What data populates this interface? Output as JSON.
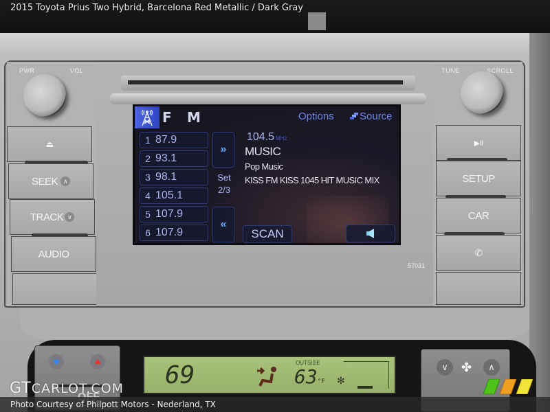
{
  "title": "2015 Toyota Prius Two Hybrid,  Barcelona Red Metallic / Dark Gray",
  "caption": "Photo Courtesy of Philpott Motors - Nederland, TX",
  "watermark": {
    "prefix": "GT",
    "rest": "CARLOT.COM"
  },
  "head_unit": {
    "left_knob": {
      "label_left": "PWR",
      "label_right": "VOL"
    },
    "right_knob": {
      "label_left": "TUNE",
      "label_right": "SCROLL"
    },
    "left_buttons": [
      {
        "id": "eject",
        "label": "⏏"
      },
      {
        "id": "seek",
        "label": "SEEK"
      },
      {
        "id": "track",
        "label": "TRACK"
      },
      {
        "id": "audio",
        "label": "AUDIO"
      }
    ],
    "right_buttons": [
      {
        "id": "play-pause",
        "label": "▶II"
      },
      {
        "id": "setup",
        "label": "SETUP"
      },
      {
        "id": "car",
        "label": "CAR"
      },
      {
        "id": "phone",
        "label": "✆"
      }
    ],
    "part_code": "57031"
  },
  "screen": {
    "bands": [
      "F",
      "M"
    ],
    "active_band": "FM",
    "options_label": "Options",
    "source_label": "Source",
    "presets": [
      {
        "num": "1",
        "freq": "87.9"
      },
      {
        "num": "2",
        "freq": "93.1"
      },
      {
        "num": "3",
        "freq": "98.1"
      },
      {
        "num": "4",
        "freq": "105.1"
      },
      {
        "num": "5",
        "freq": "107.9"
      },
      {
        "num": "6",
        "freq": "107.9"
      }
    ],
    "next_page": "»",
    "prev_page": "«",
    "set_label": "Set",
    "set_page": "2/3",
    "current_freq": "104.5",
    "current_unit": "MHz",
    "genre": "MUSIC",
    "sub_genre": "Pop Music",
    "rds_text": "KISS FM KISS 1045 HIT MUSIC MIX",
    "scan_label": "SCAN",
    "accent_color": "#6c86f0"
  },
  "climate": {
    "set_temp": "69",
    "outside_label": "OUTSIDE",
    "outside_temp": "63",
    "outside_unit": "°F",
    "off_label": "OFF",
    "fan_down": "∨",
    "fan_up": "∧"
  }
}
